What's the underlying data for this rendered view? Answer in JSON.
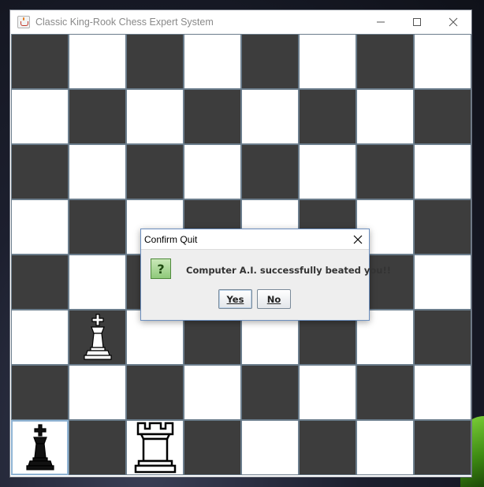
{
  "window": {
    "title": "Classic King-Rook Chess Expert System",
    "controls": [
      "minimize",
      "maximize",
      "close"
    ]
  },
  "board": {
    "size": 8,
    "colors": {
      "dark": "#3d3d3d",
      "light": "#ffffff"
    },
    "pieces": [
      {
        "row": 5,
        "col": 1,
        "piece": "king",
        "color": "white"
      },
      {
        "row": 7,
        "col": 0,
        "piece": "king",
        "color": "black"
      },
      {
        "row": 7,
        "col": 2,
        "piece": "rook",
        "color": "white"
      }
    ],
    "selected_square": {
      "row": 7,
      "col": 0
    }
  },
  "dialog": {
    "title": "Confirm Quit",
    "icon": "question-icon",
    "message": "Computer A.I. successfully beated you!!",
    "buttons": {
      "yes": "Yes",
      "no": "No"
    }
  }
}
